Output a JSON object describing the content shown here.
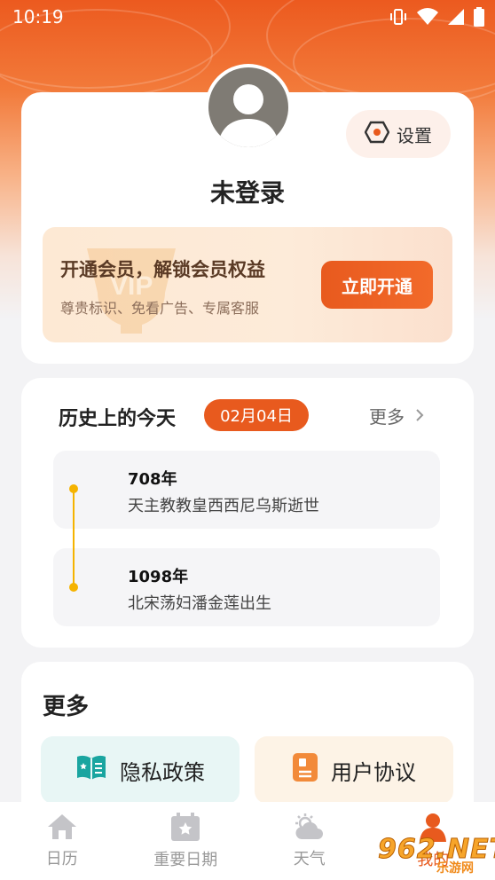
{
  "status_bar": {
    "time": "10:19"
  },
  "profile": {
    "username": "未登录",
    "settings_label": "设置"
  },
  "vip": {
    "title": "开通会员，解锁会员权益",
    "subtitle": "尊贵标识、免看广告、专属客服",
    "button_label": "立即开通"
  },
  "history": {
    "title": "历史上的今天",
    "date_badge": "02月04日",
    "more_label": "更多",
    "events": [
      {
        "year": "708年",
        "description": "天主教教皇西西尼乌斯逝世"
      },
      {
        "year": "1098年",
        "description": "北宋荡妇潘金莲出生"
      }
    ]
  },
  "more_section": {
    "title": "更多",
    "items": [
      {
        "label": "隐私政策",
        "icon": "book-icon"
      },
      {
        "label": "用户协议",
        "icon": "document-icon"
      }
    ]
  },
  "bottom_nav": {
    "items": [
      {
        "label": "日历",
        "icon": "home-icon"
      },
      {
        "label": "重要日期",
        "icon": "calendar-star-icon"
      },
      {
        "label": "天气",
        "icon": "weather-icon"
      },
      {
        "label": "我的",
        "icon": "user-icon"
      }
    ]
  },
  "watermark": {
    "main": "962.NET",
    "sub": "乐游网"
  },
  "colors": {
    "accent": "#e85a1e",
    "timeline": "#f5b300",
    "privacy_icon": "#1aa5a0",
    "agreement_icon": "#f28a3a"
  }
}
